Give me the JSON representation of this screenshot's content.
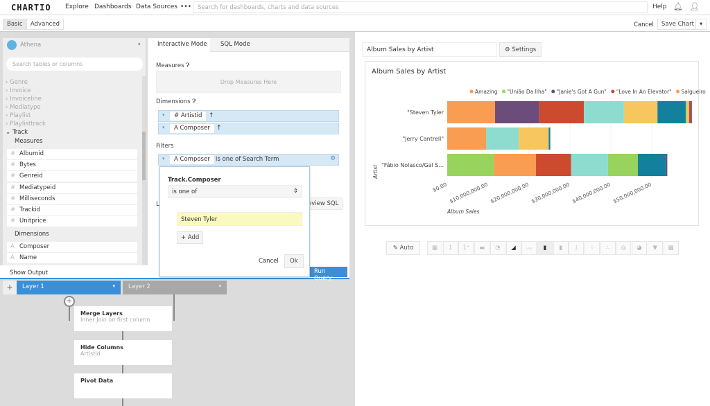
{
  "nav": {
    "logo": "CHARTIO",
    "items": [
      "Explore",
      "Dashboards",
      "Data Sources",
      "•••"
    ],
    "search_placeholder": "Search for dashboards, charts and data sources",
    "help": "Help"
  },
  "modes": {
    "basic": "Basic",
    "advanced": "Advanced",
    "cancel": "Cancel",
    "save": "Save Chart"
  },
  "datasource": {
    "name": "Athena",
    "search_placeholder": "Search tables or columns",
    "tables": [
      "Genre",
      "Invoice",
      "Invoiceline",
      "Mediatype",
      "Playlist",
      "Playlisttrack"
    ],
    "open_table": "Track",
    "measures_label": "Measures",
    "measures": [
      "Albumid",
      "Bytes",
      "Genreid",
      "Mediatypeid",
      "Milliseconds",
      "Trackid",
      "Unitprice"
    ],
    "dimensions_label": "Dimensions",
    "dimensions": [
      "Composer",
      "Name"
    ]
  },
  "query": {
    "tabs": [
      "Interactive Mode",
      "SQL Mode"
    ],
    "measures_label": "Measures",
    "drop_measures": "Drop Measures Here",
    "dimensions_label": "Dimensions",
    "dimensions": [
      "Artistid",
      "Composer"
    ],
    "filters_label": "Filters",
    "filter": {
      "field": "Composer",
      "text": "is one of Search Term"
    },
    "limit_partial": "L",
    "preview_sql": "eview SQL",
    "run": "Run Query",
    "show_output": "Show Output"
  },
  "popup": {
    "title": "Track.Composer",
    "operator": "is one of",
    "value": "Steven Tyler",
    "add": "+ Add",
    "cancel": "Cancel",
    "ok": "Ok"
  },
  "pipeline": {
    "layers": [
      "Layer 1",
      "Layer 2"
    ],
    "steps": [
      {
        "title": "Merge Layers",
        "sub": "Inner Join on first column"
      },
      {
        "title": "Hide Columns",
        "sub": "Artistid"
      },
      {
        "title": "Pivot Data",
        "sub": ""
      }
    ]
  },
  "chart_panel": {
    "name": "Album Sales by Artist",
    "settings": "Settings",
    "auto": "Auto"
  },
  "chart_data": {
    "type": "bar",
    "orientation": "horizontal",
    "stacked": true,
    "title": "Album Sales by Artist",
    "xlabel": "Album Sales",
    "ylabel": "Artist",
    "xticks": [
      "$0.00",
      "$10,000,000.00",
      "$20,000,000.00",
      "$30,000,000.00",
      "$40,000,000.00",
      "$50,000,000.00"
    ],
    "xlim": [
      0,
      60000000
    ],
    "legend_position": "top",
    "legend": [
      {
        "name": "Amazing",
        "color": "#f99d52"
      },
      {
        "name": "\"União Da Ilha\"",
        "color": "#98d35e"
      },
      {
        "name": "\"Janie's Got A Gun\"",
        "color": "#6b4c7a"
      },
      {
        "name": "\"Love In An Elevator\"",
        "color": "#cc4a2e"
      },
      {
        "name": "Salgueiro",
        "color": "#f99d52"
      }
    ],
    "categories": [
      "\"Steven Tyler",
      "\"Jerry Cantrell\"",
      "\"Fábio Nolasco/Gal S..."
    ],
    "bars": [
      [
        {
          "v": 11700000,
          "c": "#f99d52"
        },
        {
          "v": 10800000,
          "c": "#6b4c7a"
        },
        {
          "v": 10900000,
          "c": "#cc4a2e"
        },
        {
          "v": 9800000,
          "c": "#8ddccf"
        },
        {
          "v": 8200000,
          "c": "#f7c65e"
        },
        {
          "v": 6900000,
          "c": "#13809e"
        },
        {
          "v": 300000,
          "c": "#98d35e"
        },
        {
          "v": 500000,
          "c": "#f7c65e"
        },
        {
          "v": 400000,
          "c": "#cc4a2e"
        },
        {
          "v": 300000,
          "c": "#6b4c7a"
        }
      ],
      [
        {
          "v": 9500000,
          "c": "#f99d52"
        },
        {
          "v": 8000000,
          "c": "#8ddccf"
        },
        {
          "v": 7300000,
          "c": "#f7c65e"
        },
        {
          "v": 400000,
          "c": "#13809e"
        }
      ],
      [
        {
          "v": 11400000,
          "c": "#98d35e"
        },
        {
          "v": 10300000,
          "c": "#f99d52"
        },
        {
          "v": 8600000,
          "c": "#cc4a2e"
        },
        {
          "v": 9000000,
          "c": "#8ddccf"
        },
        {
          "v": 7300000,
          "c": "#98d35e"
        },
        {
          "v": 6900000,
          "c": "#13809e"
        },
        {
          "v": 300000,
          "c": "#6b4c7a"
        }
      ]
    ]
  },
  "chart_types": [
    "table",
    "single-value",
    "single-value-trend",
    "progress",
    "pie",
    "area",
    "line",
    "bar",
    "bar-line",
    "box",
    "scatter",
    "bubble",
    "donut",
    "gauge",
    "funnel",
    "map"
  ],
  "colors": {
    "accent": "#3a8fd6",
    "layer_inactive": "#a8a8a8"
  }
}
